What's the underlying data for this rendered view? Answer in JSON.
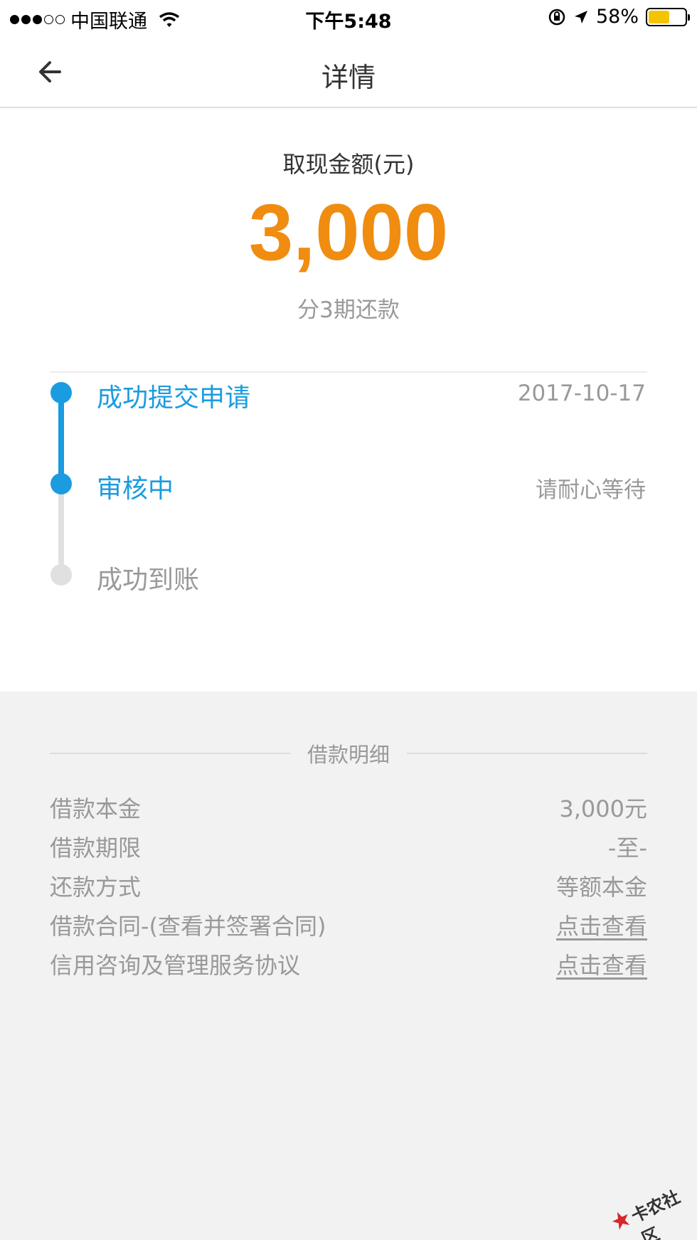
{
  "status_bar": {
    "carrier": "中国联通",
    "time": "下午5:48",
    "battery_percent": "58%",
    "battery_level": 0.58,
    "battery_color": "#f5c400"
  },
  "nav": {
    "title": "详情",
    "back_icon": "arrow-left-icon"
  },
  "summary": {
    "amount_label": "取现金额(元)",
    "amount": "3,000",
    "installments": "分3期还款",
    "amount_color": "#f08c10"
  },
  "timeline": {
    "accent_color": "#1b9be0",
    "steps": [
      {
        "label": "成功提交申请",
        "note": "2017-10-17",
        "active": true
      },
      {
        "label": "审核中",
        "note": "请耐心等待",
        "active": true
      },
      {
        "label": "成功到账",
        "note": "",
        "active": false
      }
    ]
  },
  "details": {
    "section_title": "借款明细",
    "rows": [
      {
        "key": "借款本金",
        "value": "3,000元"
      },
      {
        "key": "借款期限",
        "value": "-至-"
      },
      {
        "key": "还款方式",
        "value": "等额本金"
      },
      {
        "key": "借款合同-(查看并签署合同)",
        "value": "点击查看"
      },
      {
        "key": "信用咨询及管理服务协议",
        "value": "点击查看"
      }
    ]
  },
  "watermark": {
    "text": "卡农社区",
    "icon": "star-logo-icon"
  }
}
